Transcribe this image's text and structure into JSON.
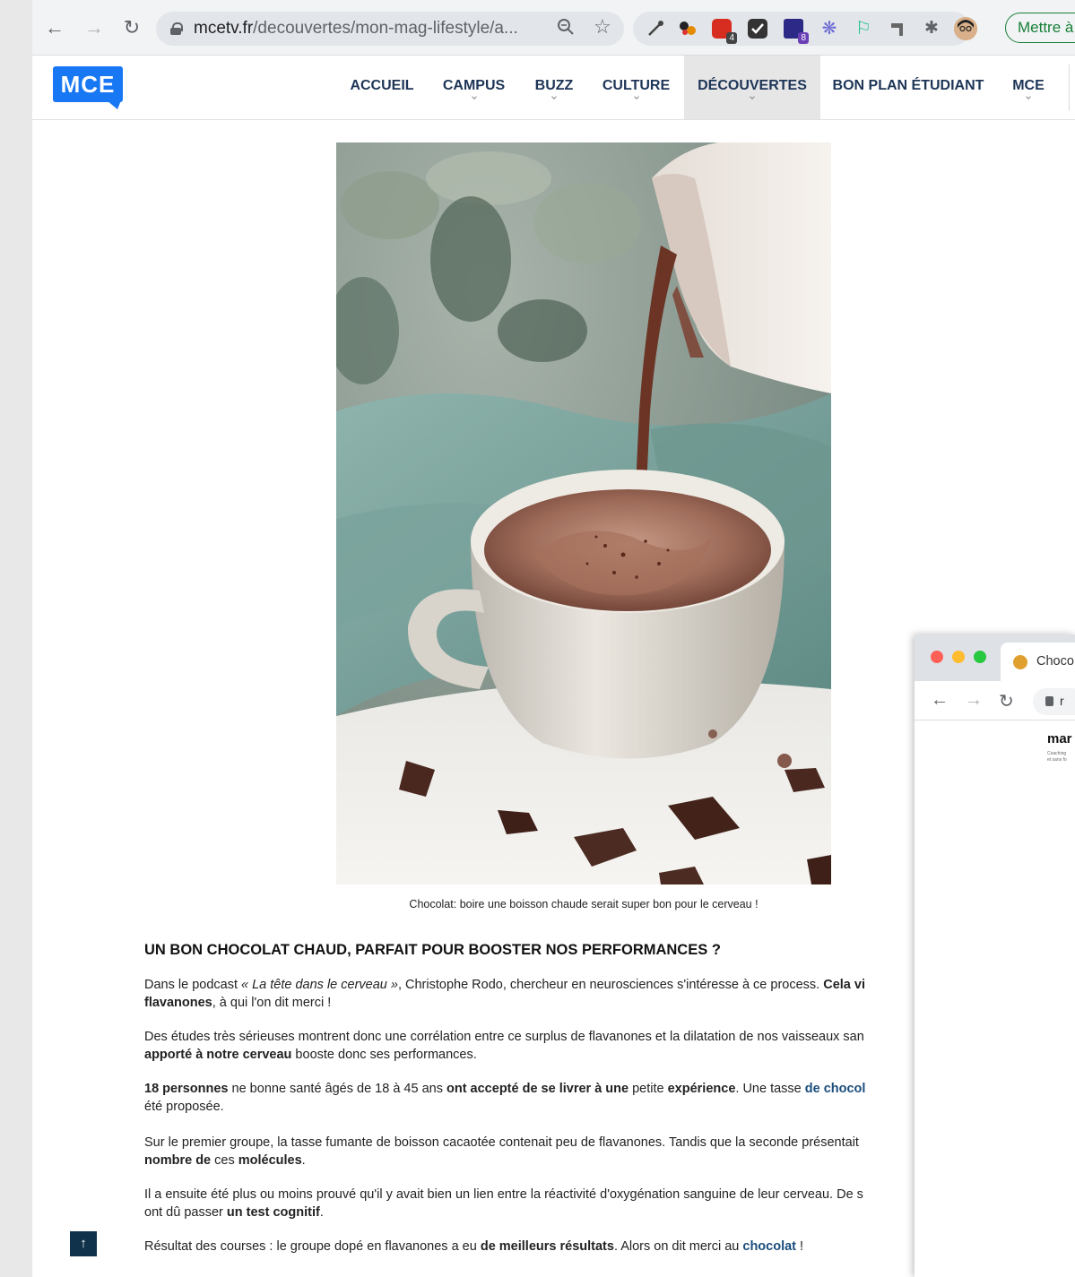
{
  "browser": {
    "url_host": "mcetv.fr",
    "url_path": "/decouvertes/mon-mag-lifestyle/a...",
    "update_button": "Mettre à",
    "ext_badges": [
      "4",
      "8"
    ]
  },
  "site": {
    "logo_text": "MCE",
    "nav": [
      {
        "label": "ACCUEIL"
      },
      {
        "label": "CAMPUS"
      },
      {
        "label": "BUZZ"
      },
      {
        "label": "CULTURE"
      },
      {
        "label": "DÉCOUVERTES",
        "active": true
      },
      {
        "label": "BON PLAN ÉTUDIANT"
      },
      {
        "label": "MCE"
      }
    ]
  },
  "article": {
    "caption": "Chocolat: boire une boisson chaude serait super bon pour le cerveau !",
    "heading": "UN BON CHOCOLAT CHAUD, PARFAIT POUR BOOSTER NOS PERFORMANCES ?",
    "p1": {
      "a": "Dans le podcast ",
      "b": "« La tête dans le cerveau »",
      "c": ", Christophe Rodo, chercheur en neurosciences s'intéresse à ce process. ",
      "d": "Cela vi",
      "e": "flavanones",
      "f": ", à qui l'on dit merci !"
    },
    "p2": {
      "a": "Des études très sérieuses montrent donc une corrélation entre ce surplus de flavanones et la dilatation de nos vaisseaux san",
      "b": "apporté à notre cerveau",
      "c": " booste donc ses performances."
    },
    "p3": {
      "a": "18 personnes",
      "b": " ne bonne santé âgés de 18 à 45 ans ",
      "c": "ont accepté de se livrer à une",
      "d": " petite ",
      "e": "expérience",
      "f": ". Une tasse ",
      "g": "de chocol",
      "h": "été proposée."
    },
    "p4": {
      "a": "Sur le premier groupe, la tasse fumante de boisson cacaotée contenait peu de flavanones. Tandis que la seconde présentait ",
      "b": "nombre de",
      "c": " ces ",
      "d": "molécules",
      "e": "."
    },
    "p5": {
      "a": "Il a ensuite été plus ou moins prouvé qu'il y avait bien un lien entre la réactivité d'oxygénation sanguine de leur cerveau. De s",
      "b": "ont dû passer ",
      "c": "un test cognitif",
      "d": "."
    },
    "p6": {
      "a": "Résultat des courses : le groupe dopé en flavanones a eu ",
      "b": "de meilleurs résultats",
      "c": ". Alors on dit merci au ",
      "d": "chocolat",
      "e": " !"
    }
  },
  "second_window": {
    "tab_title": "Choco",
    "url_fragment": "r",
    "brand": "mar",
    "tagline_1": "Coaching",
    "tagline_2": "et sans fo"
  },
  "colors": {
    "brand_blue": "#1877f2",
    "nav_text": "#1d3557",
    "link": "#1a4d7c",
    "update_green": "#188038"
  }
}
